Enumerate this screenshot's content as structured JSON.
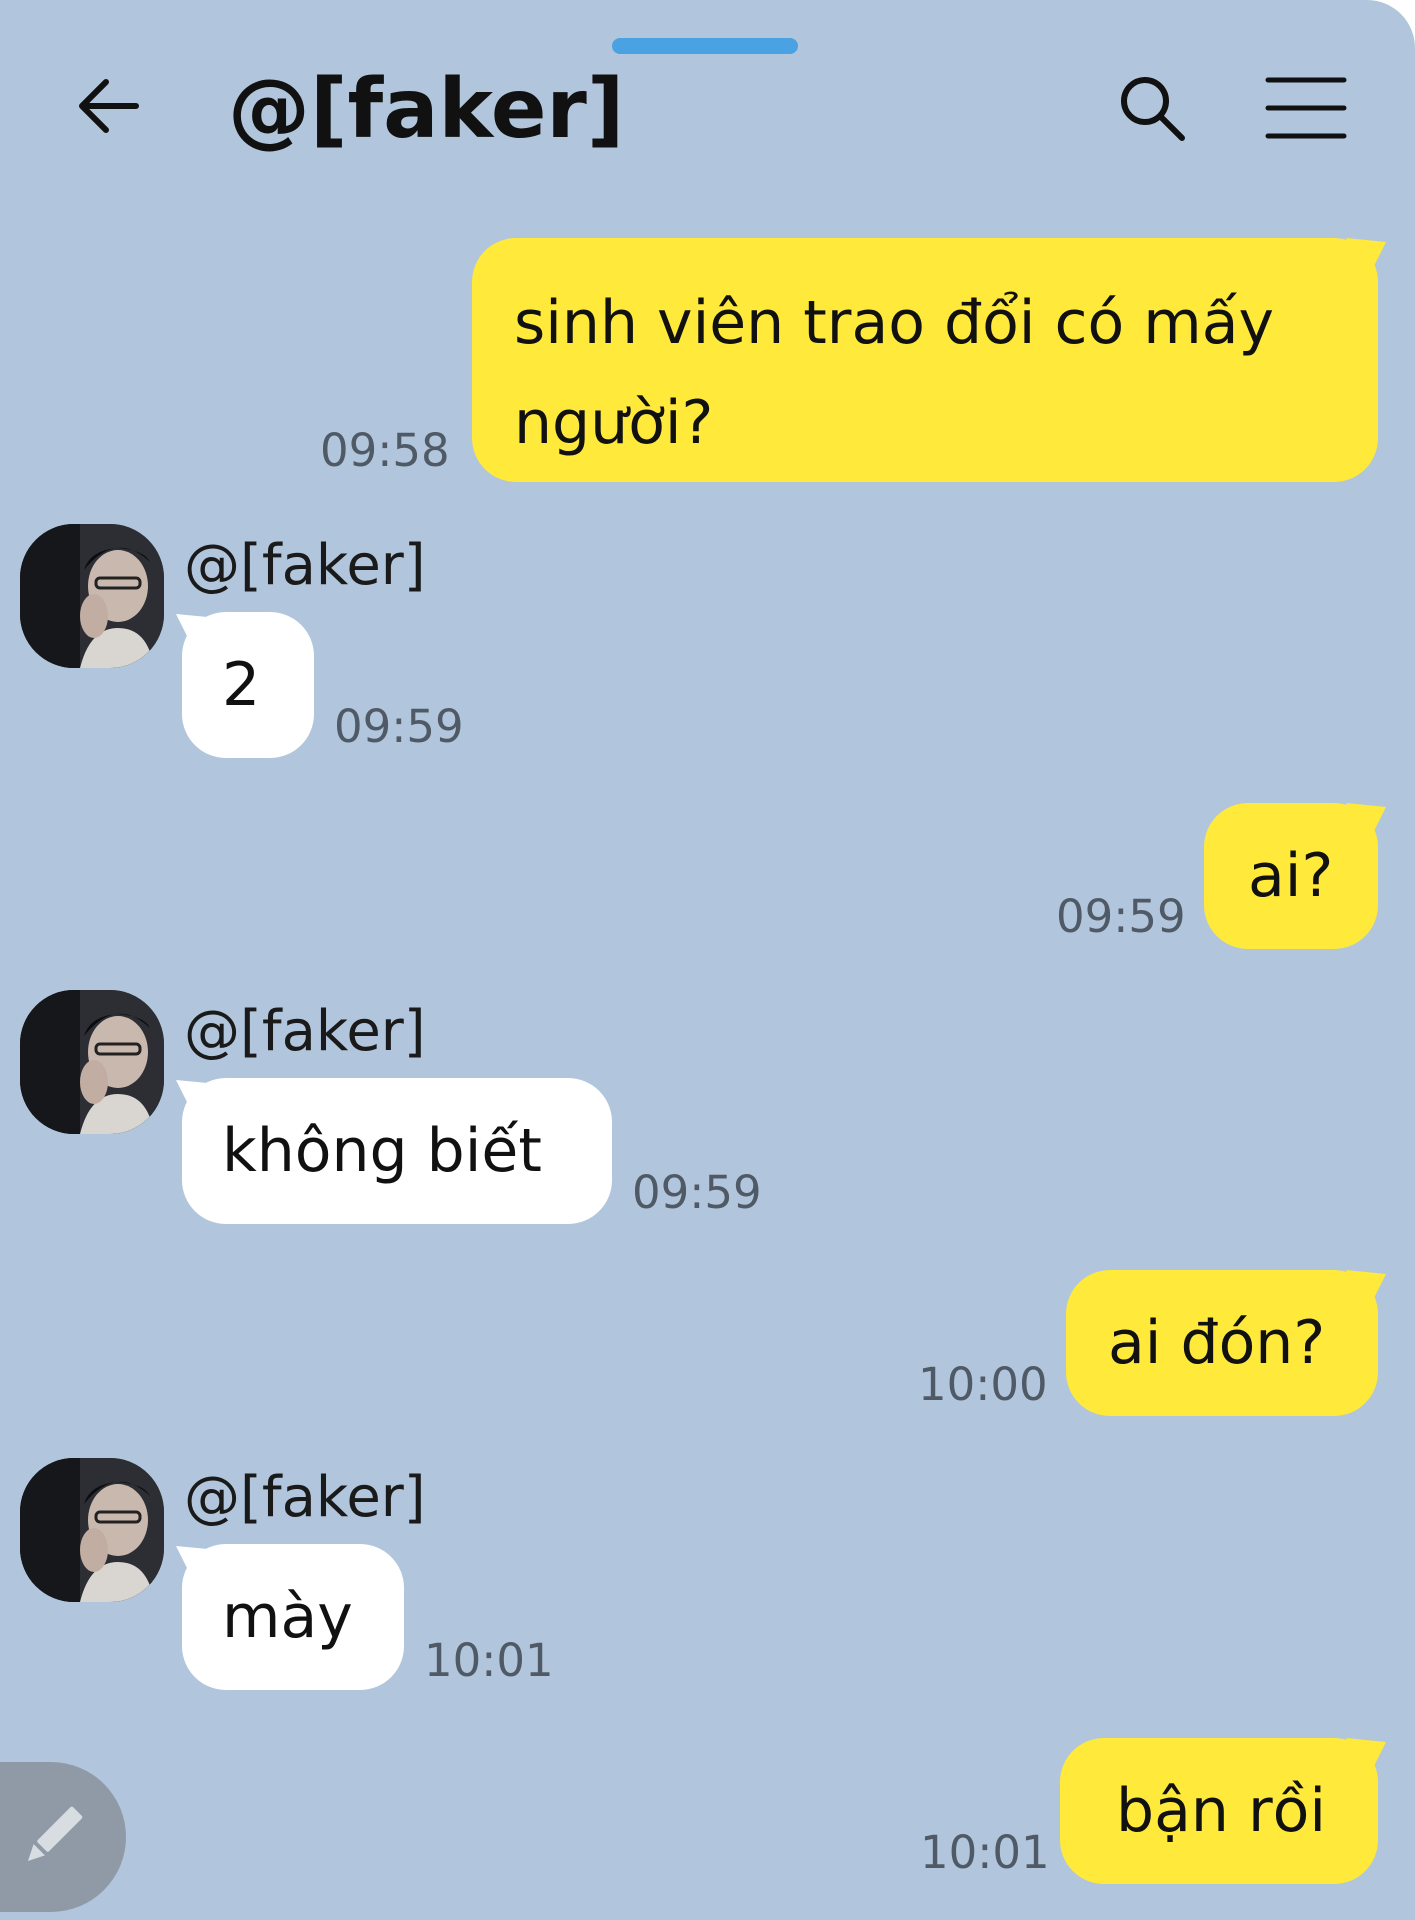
{
  "header": {
    "title": "@[faker]",
    "back_icon": "arrow-left-icon",
    "search_icon": "search-icon",
    "menu_icon": "hamburger-menu-icon"
  },
  "colors": {
    "background": "#b1c6dc",
    "outgoing_bubble": "#ffe93b",
    "incoming_bubble": "#ffffff",
    "handle": "#4aa2e2"
  },
  "messages": [
    {
      "direction": "out",
      "lines": [
        "sinh viên trao đổi có mấy",
        "người?"
      ],
      "time": "09:58"
    },
    {
      "direction": "in",
      "sender": "@[faker]",
      "text": "2",
      "time": "09:59"
    },
    {
      "direction": "out",
      "text": "ai?",
      "time": "09:59"
    },
    {
      "direction": "in",
      "sender": "@[faker]",
      "text": "không biết",
      "time": "09:59"
    },
    {
      "direction": "out",
      "text": "ai đón?",
      "time": "10:00"
    },
    {
      "direction": "in",
      "sender": "@[faker]",
      "text": "mày",
      "time": "10:01"
    },
    {
      "direction": "out",
      "text": "bận rồi",
      "time": "10:01"
    }
  ],
  "compose_button": {
    "icon": "pencil-icon"
  }
}
